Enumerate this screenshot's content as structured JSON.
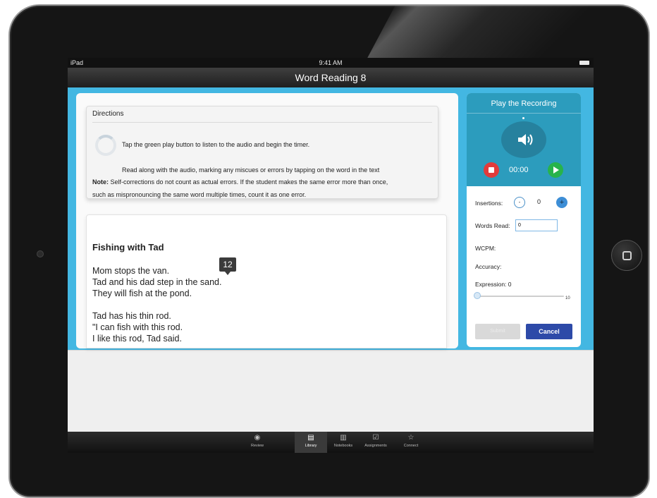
{
  "status_bar": {
    "device": "iPad",
    "time": "9:41 AM"
  },
  "title": "Word Reading 8",
  "directions": {
    "heading": "Directions",
    "line1": "Tap the green play button to listen to the audio and begin the timer.",
    "line2": "Read along with the audio, marking any miscues or errors by tapping on the word in the text",
    "note_label": "Note:",
    "note_line1": "Self-corrections do not count as actual errors. If the student makes the same error more than once,",
    "note_line2": "such as mispronouncing the same word multiple times, count it as one error."
  },
  "story": {
    "title": "Fishing with Tad",
    "lines": [
      "Mom stops the van.",
      "Tad and his dad step in the sand.",
      "They will fish at the pond.",
      "Tad has his thin rod.",
      "\"I can fish with this rod.",
      "I like this rod, Tad said."
    ],
    "word_count_badge": "12"
  },
  "recording": {
    "title": "Play the Recording",
    "timer": "00:00",
    "icons": {
      "speaker": "speaker-icon",
      "stop": "stop-icon",
      "play": "play-icon"
    },
    "colors": {
      "header_bg": "#2c9cbd",
      "stop": "#e23b3b",
      "play": "#27b34b"
    }
  },
  "scoring": {
    "insertions_label": "Insertions:",
    "insertions_minus": "-",
    "insertions_value": "0",
    "insertions_plus": "+",
    "words_read_label": "Words Read:",
    "words_read_value": "0",
    "wcpm_label": "WCPM:",
    "accuracy_label": "Accuracy:",
    "expression_label": "Expression: 0",
    "expression_value": 0,
    "expression_max": "10",
    "submit_label": "Submit",
    "cancel_label": "Cancel"
  },
  "tabbar": {
    "tabs": [
      {
        "label": "Review",
        "icon": "eye-icon",
        "glyph": "◉"
      },
      {
        "label": "Library",
        "icon": "library-icon",
        "glyph": "▤"
      },
      {
        "label": "Notebooks",
        "icon": "notebook-icon",
        "glyph": "▥"
      },
      {
        "label": "Assignments",
        "icon": "checkbox-icon",
        "glyph": "☑"
      },
      {
        "label": "Connect",
        "icon": "star-icon",
        "glyph": "☆"
      }
    ],
    "active": "Library"
  },
  "colors": {
    "accent_blue": "#43b7e2",
    "cancel_button": "#2d4aa8"
  }
}
